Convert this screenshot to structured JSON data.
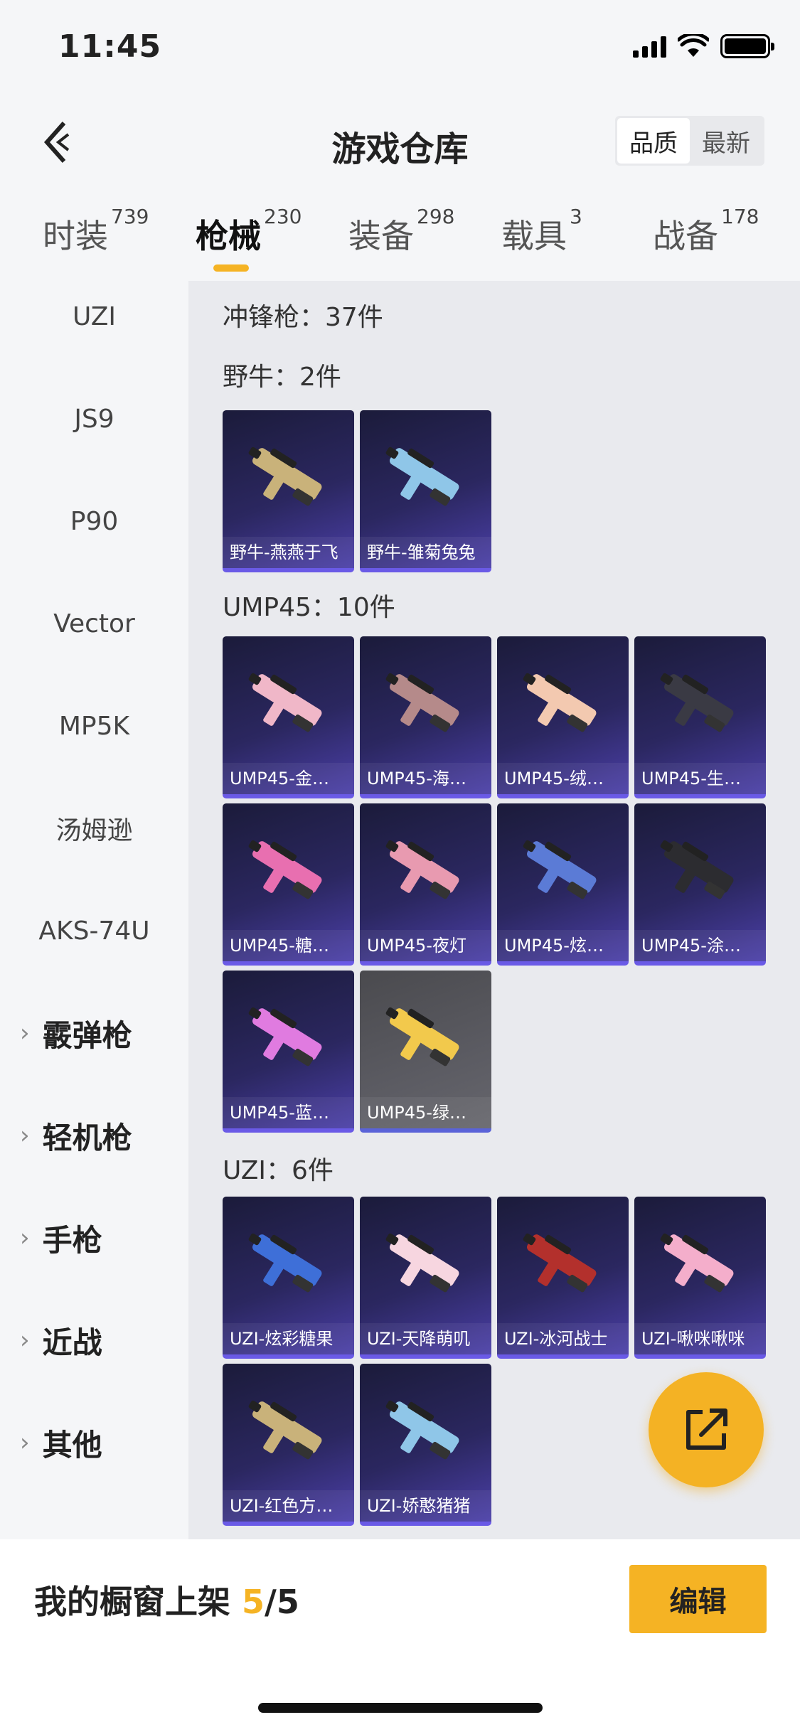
{
  "status_bar": {
    "time": "11:45"
  },
  "header": {
    "title": "游戏仓库",
    "sort_options": [
      {
        "label": "品质",
        "active": true
      },
      {
        "label": "最新",
        "active": false
      }
    ]
  },
  "tabs": [
    {
      "label": "时装",
      "count": "739",
      "active": false
    },
    {
      "label": "枪械",
      "count": "230",
      "active": true
    },
    {
      "label": "装备",
      "count": "298",
      "active": false
    },
    {
      "label": "载具",
      "count": "3",
      "active": false
    },
    {
      "label": "战备",
      "count": "178",
      "active": false
    }
  ],
  "sidebar": {
    "items": [
      "UZI",
      "JS9",
      "P90",
      "Vector",
      "MP5K",
      "汤姆逊",
      "AKS-74U"
    ],
    "groups": [
      "霰弹枪",
      "轻机枪",
      "手枪",
      "近战",
      "其他"
    ]
  },
  "content": {
    "category_title": "冲锋枪：37件",
    "sections": [
      {
        "title": "野牛：2件",
        "items": [
          "野牛-燕燕于飞",
          "野牛-雏菊兔兔"
        ]
      },
      {
        "title": "UMP45：10件",
        "items": [
          "UMP45-金…",
          "UMP45-海…",
          "UMP45-绒…",
          "UMP45-生…",
          "UMP45-糖…",
          "UMP45-夜灯",
          "UMP45-炫…",
          "UMP45-涂…",
          "UMP45-蓝…",
          "UMP45-绿…"
        ]
      },
      {
        "title": "UZI：6件",
        "items": [
          "UZI-炫彩糖果",
          "UZI-天降萌叽",
          "UZI-冰河战士",
          "UZI-啾咪啾咪",
          "UZI-红色方…",
          "UZI-娇憨猪猪"
        ]
      }
    ]
  },
  "bottom_bar": {
    "showcase_label": "我的橱窗上架",
    "showcase_count": "5",
    "showcase_total": "/5",
    "edit_label": "编辑"
  },
  "colors": {
    "accent": "#f5b324",
    "card_bg": "#2b2760",
    "card_border": "#6a5ae6"
  }
}
